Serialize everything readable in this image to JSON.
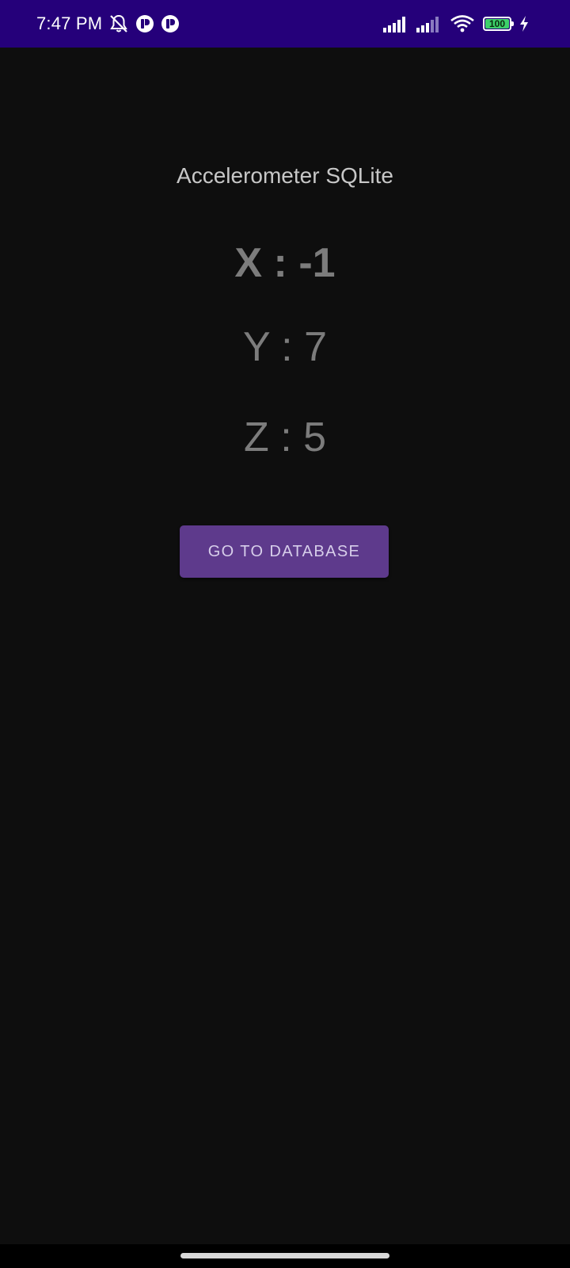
{
  "status_bar": {
    "time": "7:47 PM",
    "battery_level": "100",
    "background_color": "#25007a",
    "left_icons": [
      "bell-muted-icon",
      "app-notification-icon",
      "app-notification-icon"
    ],
    "right_icons": [
      "signal-icon",
      "signal-icon",
      "wifi-icon",
      "battery-icon",
      "charging-bolt-icon"
    ]
  },
  "main": {
    "title": "Accelerometer SQLite",
    "x_text": "X : -1",
    "y_text": "Y : 7",
    "z_text": "Z : 5",
    "button_label": "GO TO DATABASE"
  },
  "colors": {
    "background": "#0e0e0e",
    "button": "#5e3a8c",
    "axis_text": "#7c7c7c",
    "title_text": "#c7c7c7"
  }
}
